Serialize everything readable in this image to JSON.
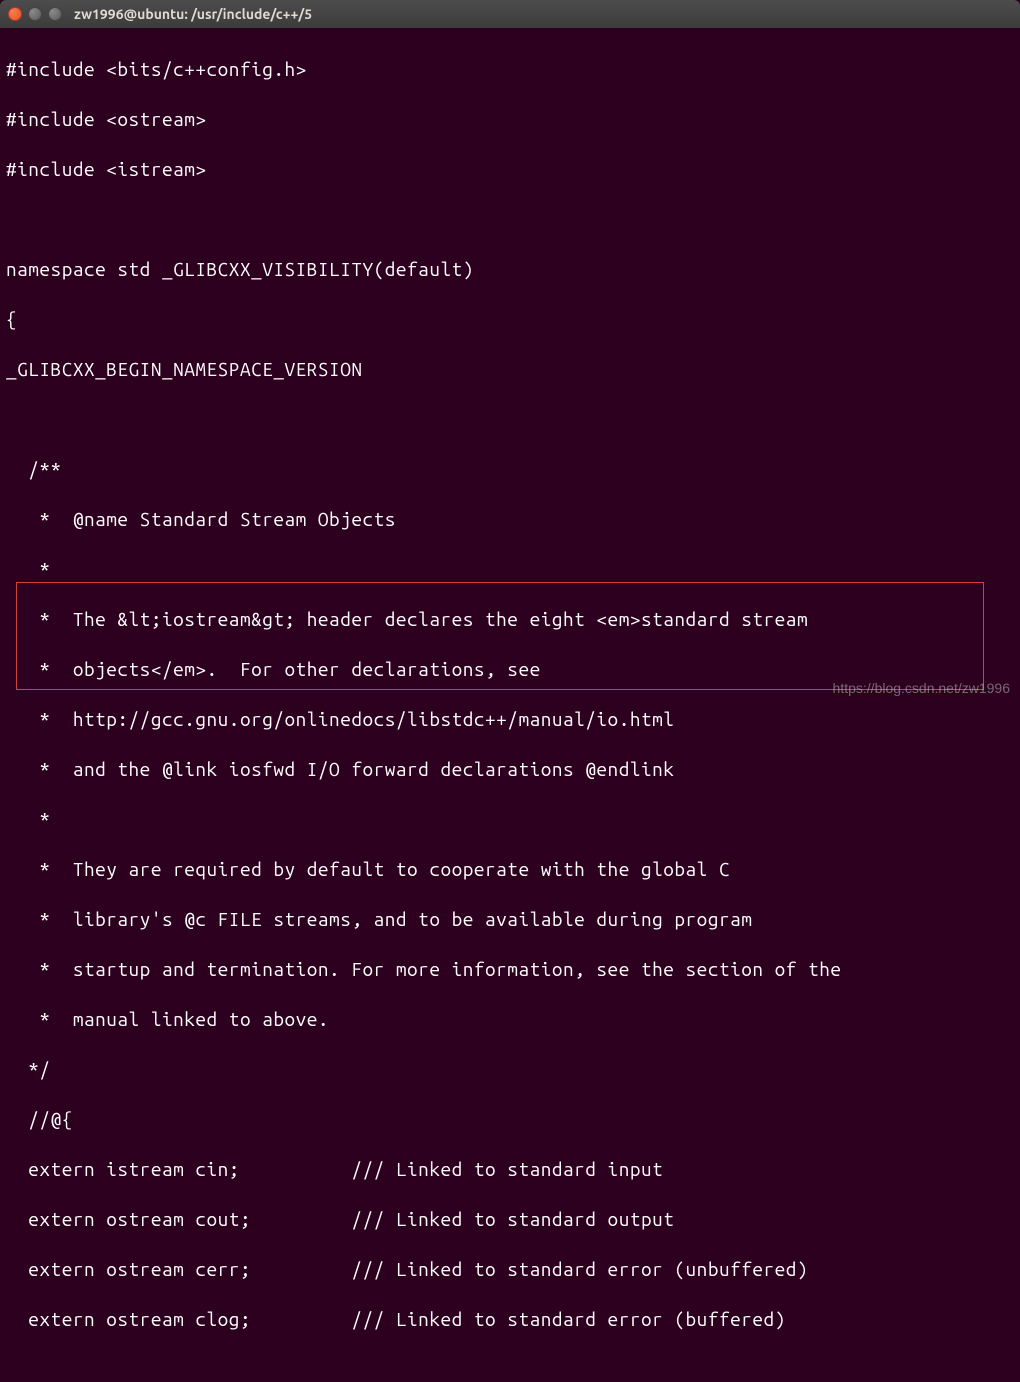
{
  "window": {
    "title": "zw1996@ubuntu: /usr/include/c++/5"
  },
  "code": {
    "l1": "#include <bits/c++config.h>",
    "l2": "#include <ostream>",
    "l3": "#include <istream>",
    "l4": "",
    "l5": "namespace std _GLIBCXX_VISIBILITY(default)",
    "l6": "{",
    "l7": "_GLIBCXX_BEGIN_NAMESPACE_VERSION",
    "l8": "",
    "l9": "  /**",
    "l10": "   *  @name Standard Stream Objects",
    "l11": "   *",
    "l12": "   *  The &lt;iostream&gt; header declares the eight <em>standard stream",
    "l13": "   *  objects</em>.  For other declarations, see",
    "l14": "   *  http://gcc.gnu.org/onlinedocs/libstdc++/manual/io.html",
    "l15": "   *  and the @link iosfwd I/O forward declarations @endlink",
    "l16": "   *",
    "l17": "   *  They are required by default to cooperate with the global C",
    "l18": "   *  library's @c FILE streams, and to be available during program",
    "l19": "   *  startup and termination. For more information, see the section of the",
    "l20": "   *  manual linked to above.",
    "l21": "  */",
    "l22": "  //@{",
    "l23": "  extern istream cin;          /// Linked to standard input",
    "l24": "  extern ostream cout;         /// Linked to standard output",
    "l25": "  extern ostream cerr;         /// Linked to standard error (unbuffered)",
    "l26": "  extern ostream clog;         /// Linked to standard error (buffered)"
  },
  "watermark": "https://blog.csdn.net/zw1996"
}
